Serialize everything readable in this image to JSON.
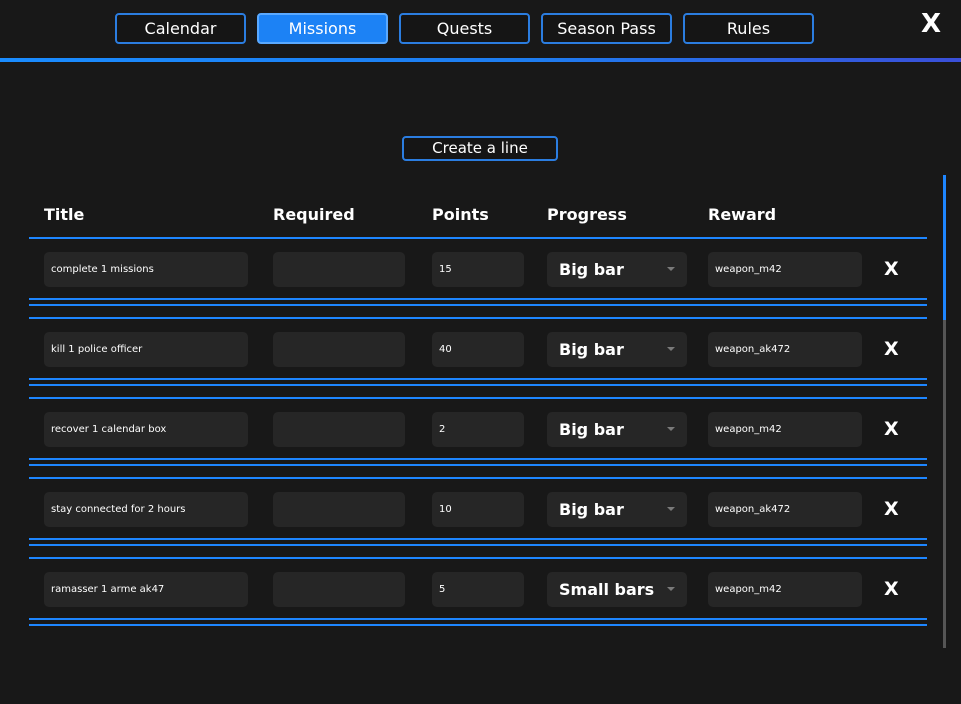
{
  "nav": {
    "tabs": [
      {
        "label": "Calendar"
      },
      {
        "label": "Missions"
      },
      {
        "label": "Quests"
      },
      {
        "label": "Season Pass"
      },
      {
        "label": "Rules"
      }
    ],
    "active_tab": "Missions",
    "close_label": "X"
  },
  "toolbar": {
    "create_label": "Create a line"
  },
  "table": {
    "headers": {
      "title": "Title",
      "required": "Required",
      "points": "Points",
      "progress": "Progress",
      "reward": "Reward"
    },
    "rows": [
      {
        "title": "complete 1 missions",
        "required": "",
        "points": "15",
        "progress": "Big bar",
        "reward": "weapon_m42",
        "delete": "X"
      },
      {
        "title": "kill 1 police officer",
        "required": "",
        "points": "40",
        "progress": "Big bar",
        "reward": "weapon_ak472",
        "delete": "X"
      },
      {
        "title": "recover 1 calendar box",
        "required": "",
        "points": "2",
        "progress": "Big bar",
        "reward": "weapon_m42",
        "delete": "X"
      },
      {
        "title": "stay connected for 2 hours",
        "required": "",
        "points": "10",
        "progress": "Big bar",
        "reward": "weapon_ak472",
        "delete": "X"
      },
      {
        "title": "ramasser 1 arme ak47",
        "required": "",
        "points": "5",
        "progress": "Small bars",
        "reward": "weapon_m42",
        "delete": "X"
      }
    ]
  },
  "colors": {
    "accent": "#1e86ff",
    "active_tab": "#1c82f5",
    "background": "#181818",
    "field": "#262626"
  }
}
